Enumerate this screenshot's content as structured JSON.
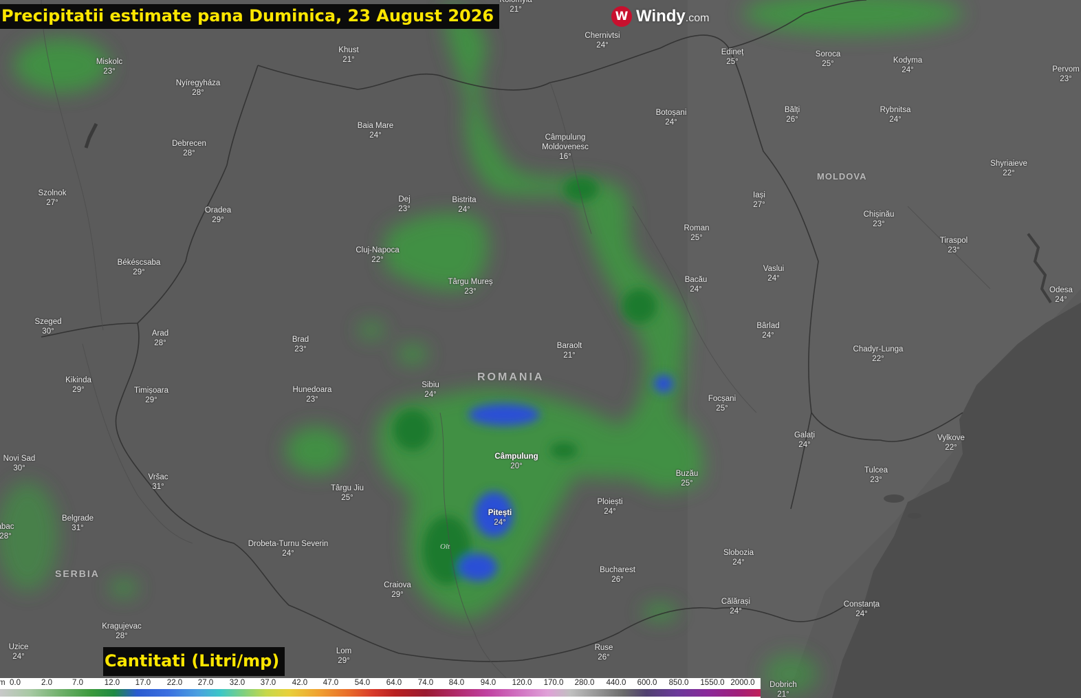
{
  "title": "Precipitatii estimate pana Duminica, 23 August 2026",
  "logo": {
    "brand": "Windy",
    "domain": ".com",
    "icon": "windy-logo-icon",
    "color": "#c8102e"
  },
  "legend": {
    "title": "Cantitati (Litri/mp)",
    "unit_prefix": "m",
    "ticks": [
      "0.0",
      "2.0",
      "7.0",
      "12.0",
      "17.0",
      "22.0",
      "27.0",
      "32.0",
      "37.0",
      "42.0",
      "47.0",
      "54.0",
      "64.0",
      "74.0",
      "84.0",
      "94.0",
      "120.0",
      "170.0",
      "280.0",
      "440.0",
      "600.0",
      "850.0",
      "1550.0",
      "2000.0"
    ]
  },
  "colors": {
    "background": "#5b5b5b",
    "title_bg": "#0b0b0b",
    "title_text": "#ffe600",
    "light_rain": "#3e9a3e",
    "heavy_rain": "#2a4fd6"
  },
  "countries": [
    {
      "name": "ROMANIA"
    },
    {
      "name": "MOLDOVA"
    },
    {
      "name": "SERBIA"
    }
  ],
  "river": "Olt",
  "cities": [
    {
      "name": "Kolomyia",
      "temp": "21°"
    },
    {
      "name": "Chernivtsi",
      "temp": "24°"
    },
    {
      "name": "Edineț",
      "temp": "25°"
    },
    {
      "name": "Soroca",
      "temp": "25°"
    },
    {
      "name": "Kodyma",
      "temp": "24°"
    },
    {
      "name": "Pervom",
      "temp": "23°"
    },
    {
      "name": "Miskolc",
      "temp": "23°"
    },
    {
      "name": "Khust",
      "temp": "21°"
    },
    {
      "name": "Nyíregyháza",
      "temp": "28°"
    },
    {
      "name": "Baia Mare",
      "temp": "24°"
    },
    {
      "name": "Debrecen",
      "temp": "28°"
    },
    {
      "name": "Botoșani",
      "temp": "24°"
    },
    {
      "name": "Bălți",
      "temp": "26°"
    },
    {
      "name": "Rybnitsa",
      "temp": "24°"
    },
    {
      "name": "Câmpulung Moldovenesc",
      "temp": "16°"
    },
    {
      "name": "Shyriaieve",
      "temp": "22°"
    },
    {
      "name": "Szolnok",
      "temp": "27°"
    },
    {
      "name": "Dej",
      "temp": "23°"
    },
    {
      "name": "Bistrita",
      "temp": "24°"
    },
    {
      "name": "Iași",
      "temp": "27°"
    },
    {
      "name": "Oradea",
      "temp": "29°"
    },
    {
      "name": "Chișinău",
      "temp": "23°"
    },
    {
      "name": "Roman",
      "temp": "25°"
    },
    {
      "name": "Tiraspol",
      "temp": "23°"
    },
    {
      "name": "Cluj-Napoca",
      "temp": "22°"
    },
    {
      "name": "Békéscsaba",
      "temp": "29°"
    },
    {
      "name": "Vaslui",
      "temp": "24°"
    },
    {
      "name": "Bacău",
      "temp": "24°"
    },
    {
      "name": "Târgu Mureș",
      "temp": "23°"
    },
    {
      "name": "Odesa",
      "temp": "24°"
    },
    {
      "name": "Szeged",
      "temp": "30°"
    },
    {
      "name": "Bârlad",
      "temp": "24°"
    },
    {
      "name": "Arad",
      "temp": "28°"
    },
    {
      "name": "Brad",
      "temp": "23°"
    },
    {
      "name": "Baraolt",
      "temp": "21°"
    },
    {
      "name": "Chadyr-Lunga",
      "temp": "22°"
    },
    {
      "name": "Kikinda",
      "temp": "29°"
    },
    {
      "name": "Timișoara",
      "temp": "29°"
    },
    {
      "name": "Sibiu",
      "temp": "24°"
    },
    {
      "name": "Hunedoara",
      "temp": "23°"
    },
    {
      "name": "Focșani",
      "temp": "25°"
    },
    {
      "name": "Galați",
      "temp": "24°"
    },
    {
      "name": "Vylkove",
      "temp": "22°"
    },
    {
      "name": "Câmpulung",
      "temp": "20°"
    },
    {
      "name": "Novi Sad",
      "temp": "30°"
    },
    {
      "name": "Vršac",
      "temp": "31°"
    },
    {
      "name": "Buzău",
      "temp": "25°"
    },
    {
      "name": "Tulcea",
      "temp": "23°"
    },
    {
      "name": "Târgu Jiu",
      "temp": "25°"
    },
    {
      "name": "Ploiești",
      "temp": "24°"
    },
    {
      "name": "Pitești",
      "temp": "24°"
    },
    {
      "name": "Belgrade",
      "temp": "31°"
    },
    {
      "name": "abac",
      "temp": "28°"
    },
    {
      "name": "Drobeta-Turnu Severin",
      "temp": "24°"
    },
    {
      "name": "Slobozia",
      "temp": "24°"
    },
    {
      "name": "Bucharest",
      "temp": "26°"
    },
    {
      "name": "Craiova",
      "temp": "29°"
    },
    {
      "name": "Călărași",
      "temp": "24°"
    },
    {
      "name": "Constanța",
      "temp": "24°"
    },
    {
      "name": "Kragujevac",
      "temp": "28°"
    },
    {
      "name": "Uzice",
      "temp": "24°"
    },
    {
      "name": "Lom",
      "temp": "29°"
    },
    {
      "name": "Ruse",
      "temp": "26°"
    },
    {
      "name": "Dobrich",
      "temp": "21°"
    }
  ]
}
